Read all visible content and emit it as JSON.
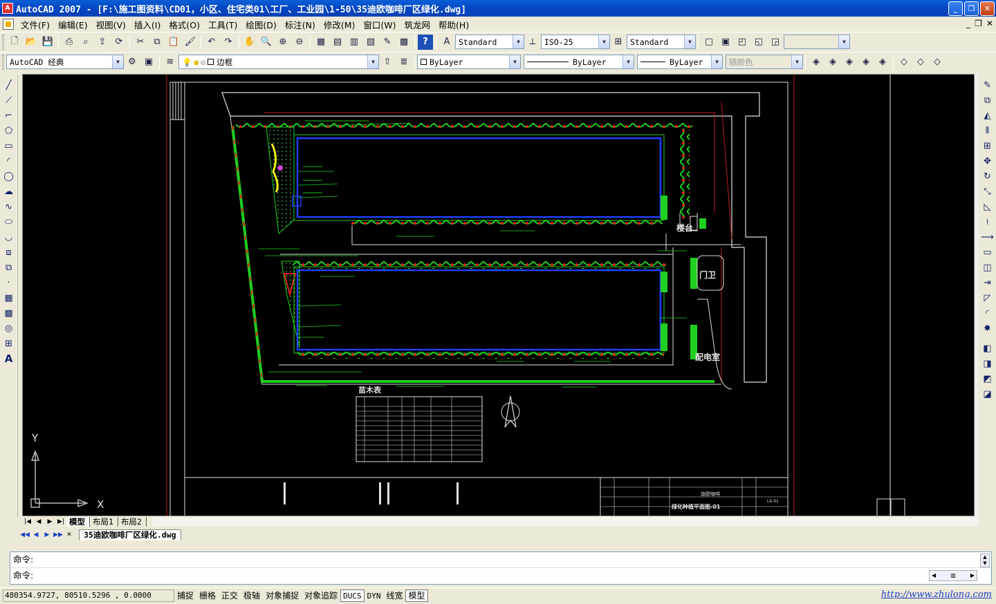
{
  "window": {
    "title": "AutoCAD 2007 - [F:\\施工图资料\\CD01，小区、住宅类01\\工厂、工业园\\1-50\\35迪欧咖啡厂区绿化.dwg]",
    "app_icon_text": "A"
  },
  "menu": {
    "items": [
      "文件(F)",
      "编辑(E)",
      "视图(V)",
      "插入(I)",
      "格式(O)",
      "工具(T)",
      "绘图(D)",
      "标注(N)",
      "修改(M)",
      "窗口(W)",
      "筑龙网",
      "帮助(H)"
    ]
  },
  "toolbar": {
    "text_style": "Standard",
    "dim_style": "ISO-25",
    "table_style": "Standard",
    "workspace": "AutoCAD 经典",
    "layer": "边框",
    "color": "ByLayer",
    "linetype": "ByLayer",
    "lineweight": "ByLayer",
    "plotstyle": "随颜色"
  },
  "drawing": {
    "labels": {
      "tree_table_title": "苗木表",
      "gate": "门卫",
      "distribution": "配电室",
      "platform": "楼台",
      "title_block_name": "绿化种植平面图-01",
      "project_name": "迪欧咖啡",
      "sheet_no": "LS-01"
    },
    "ucs": {
      "y": "Y",
      "x": "X"
    }
  },
  "layout_tabs": {
    "items": [
      "模型",
      "布局1",
      "布局2"
    ],
    "active": "模型"
  },
  "document_tab": "35迪欧咖啡厂区绿化.dwg",
  "command": {
    "line1": "命令:",
    "line2": "命令:"
  },
  "status": {
    "coords": "480354.9727, 80510.5296 , 0.0000",
    "buttons": [
      "捕捉",
      "栅格",
      "正交",
      "极轴",
      "对象捕捉",
      "对象追踪",
      "DUCS",
      "DYN",
      "线宽",
      "模型"
    ],
    "link": "http://www.zhulong.com"
  }
}
